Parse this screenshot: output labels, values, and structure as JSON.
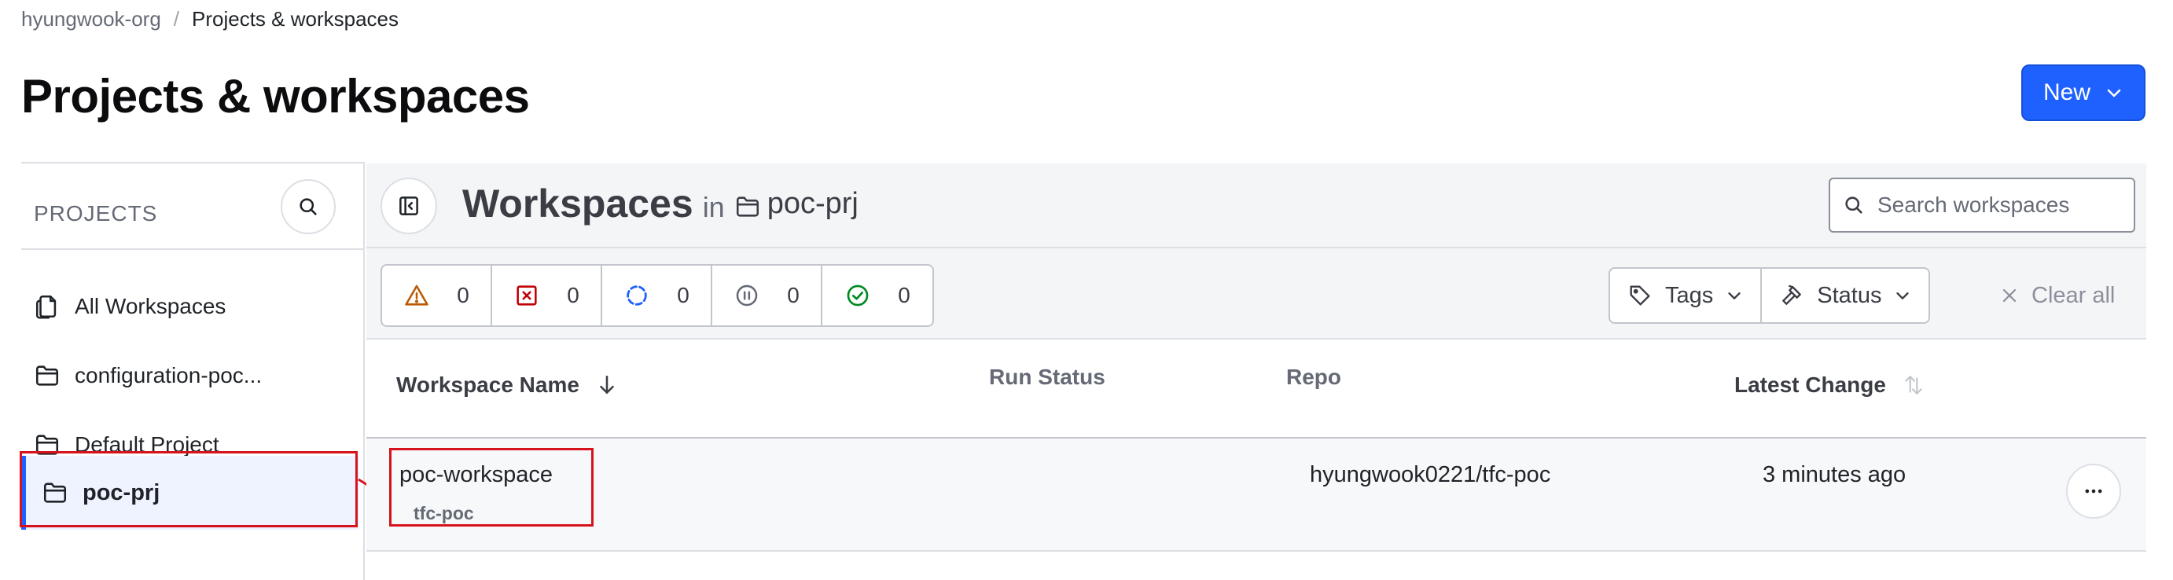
{
  "breadcrumb": {
    "org": "hyungwook-org",
    "separator": "/",
    "current": "Projects & workspaces"
  },
  "page": {
    "title": "Projects & workspaces",
    "new_button_label": "New"
  },
  "sidebar": {
    "heading": "PROJECTS",
    "items": [
      {
        "label": "All Workspaces",
        "icon": "files-icon"
      },
      {
        "label": "configuration-poc...",
        "icon": "folder-icon"
      },
      {
        "label": "Default Project",
        "icon": "folder-icon"
      },
      {
        "label": "poc-prj",
        "icon": "folder-icon",
        "selected": true
      }
    ]
  },
  "workspaces": {
    "title": "Workspaces",
    "in_label": "in",
    "project_name": "poc-prj",
    "search_placeholder": "Search workspaces"
  },
  "filters": {
    "status_counts": [
      {
        "icon": "warning-icon",
        "count": "0",
        "color": "#bb5a00"
      },
      {
        "icon": "error-square-icon",
        "count": "0",
        "color": "#c00005"
      },
      {
        "icon": "running-icon",
        "count": "0",
        "color": "#1f61ff"
      },
      {
        "icon": "paused-icon",
        "count": "0",
        "color": "#656a76"
      },
      {
        "icon": "success-icon",
        "count": "0",
        "color": "#008a22"
      }
    ],
    "tags_label": "Tags",
    "status_label": "Status",
    "clear_all_label": "Clear all"
  },
  "table": {
    "columns": {
      "name": "Workspace Name",
      "run_status": "Run Status",
      "repo": "Repo",
      "latest_change": "Latest Change"
    },
    "rows": [
      {
        "name": "poc-workspace",
        "tag": "tfc-poc",
        "run_status": "",
        "repo": "hyungwook0221/tfc-poc",
        "latest_change": "3 minutes ago"
      }
    ]
  },
  "colors": {
    "accent": "#1f61ff",
    "annotation": "#d6131d"
  }
}
